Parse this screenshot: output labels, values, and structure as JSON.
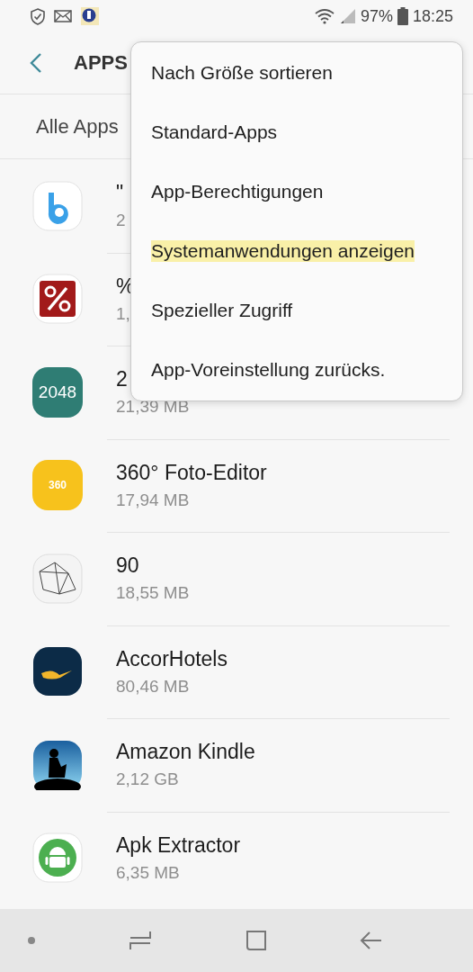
{
  "status_bar": {
    "battery": "97%",
    "time": "18:25"
  },
  "header": {
    "title": "APPS"
  },
  "filter": {
    "label": "Alle Apps"
  },
  "apps": [
    {
      "name": "\"",
      "size": "2"
    },
    {
      "name": "%",
      "size": "1,"
    },
    {
      "name": "2",
      "size": "21,39 MB",
      "icon_label": "2048"
    },
    {
      "name": "360° Foto-Editor",
      "size": "17,94 MB",
      "icon_label": "360"
    },
    {
      "name": "90",
      "size": "18,55 MB"
    },
    {
      "name": "AccorHotels",
      "size": "80,46 MB"
    },
    {
      "name": "Amazon Kindle",
      "size": "2,12 GB"
    },
    {
      "name": "Apk Extractor",
      "size": "6,35 MB"
    }
  ],
  "menu": [
    {
      "label": "Nach Größe sortieren",
      "highlighted": false
    },
    {
      "label": "Standard-Apps",
      "highlighted": false
    },
    {
      "label": "App-Berechtigungen",
      "highlighted": false
    },
    {
      "label": "Systemanwendungen anzeigen",
      "highlighted": true
    },
    {
      "label": "Spezieller Zugriff",
      "highlighted": false
    },
    {
      "label": "App-Voreinstellung zurücks.",
      "highlighted": false
    }
  ]
}
